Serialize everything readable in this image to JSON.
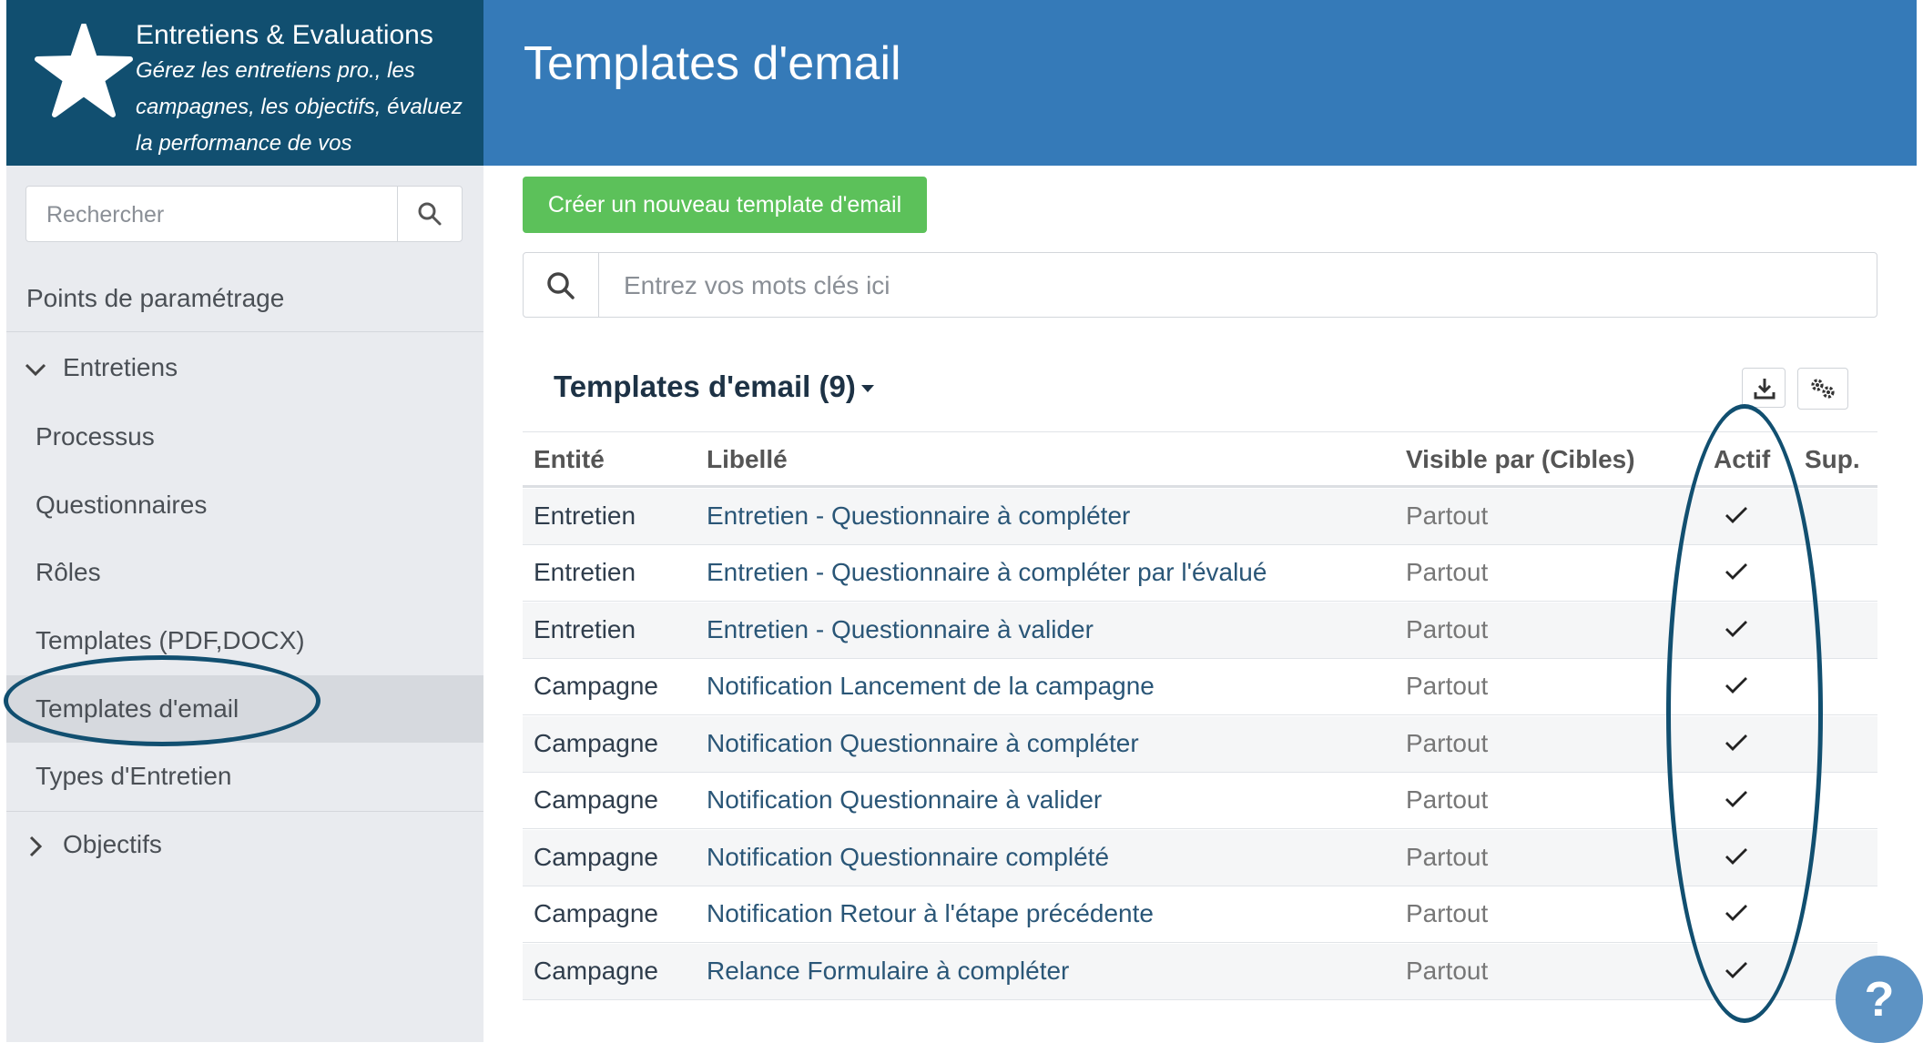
{
  "brand": {
    "title": "Entretiens & Evaluations",
    "description": "Gérez les entretiens pro., les campagnes, les objectifs, évaluez la performance de vos",
    "icon": "star-icon"
  },
  "header": {
    "title": "Templates d'email"
  },
  "sidebar": {
    "search_placeholder": "Rechercher",
    "section_title": "Points de paramétrage",
    "groups": [
      {
        "label": "Entretiens",
        "expanded": true
      },
      {
        "label": "Objectifs",
        "expanded": false
      }
    ],
    "items": [
      {
        "label": "Processus"
      },
      {
        "label": "Questionnaires"
      },
      {
        "label": "Rôles"
      },
      {
        "label": "Templates (PDF,DOCX)"
      },
      {
        "label": "Templates d'email",
        "active": true
      },
      {
        "label": "Types d'Entretien"
      }
    ]
  },
  "main": {
    "create_button": "Créer un nouveau template d'email",
    "search_placeholder": "Entrez vos mots clés ici",
    "list_title": "Templates d'email (9)",
    "columns": [
      "Entité",
      "Libellé",
      "Visible par (Cibles)",
      "Actif",
      "Sup."
    ],
    "rows": [
      {
        "entite": "Entretien",
        "libelle": "Entretien - Questionnaire à compléter",
        "visible": "Partout",
        "actif": true
      },
      {
        "entite": "Entretien",
        "libelle": "Entretien - Questionnaire à compléter par l'évalué",
        "visible": "Partout",
        "actif": true
      },
      {
        "entite": "Entretien",
        "libelle": "Entretien - Questionnaire à valider",
        "visible": "Partout",
        "actif": true
      },
      {
        "entite": "Campagne",
        "libelle": "Notification Lancement de la campagne",
        "visible": "Partout",
        "actif": true
      },
      {
        "entite": "Campagne",
        "libelle": "Notification Questionnaire à compléter",
        "visible": "Partout",
        "actif": true
      },
      {
        "entite": "Campagne",
        "libelle": "Notification Questionnaire à valider",
        "visible": "Partout",
        "actif": true
      },
      {
        "entite": "Campagne",
        "libelle": "Notification Questionnaire complété",
        "visible": "Partout",
        "actif": true
      },
      {
        "entite": "Campagne",
        "libelle": "Notification Retour à l'étape précédente",
        "visible": "Partout",
        "actif": true
      },
      {
        "entite": "Campagne",
        "libelle": "Relance Formulaire à compléter",
        "visible": "Partout",
        "actif": true
      }
    ]
  },
  "help": {
    "label": "?"
  },
  "colors": {
    "brand_dark": "#114f70",
    "header_blue": "#357ab8",
    "create_green": "#5cc15a",
    "annotation": "#114f70"
  }
}
